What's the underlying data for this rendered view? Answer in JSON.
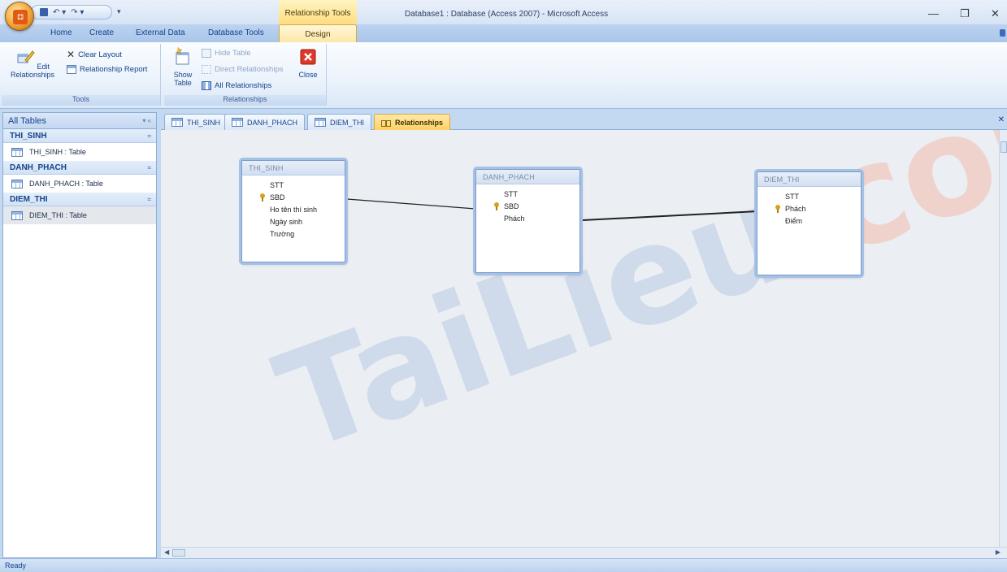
{
  "window": {
    "title": "Database1 : Database (Access 2007) - Microsoft Access",
    "context_tab_title": "Relationship Tools",
    "minimize": "—",
    "restore": "❐",
    "close": "✕"
  },
  "qat": {
    "undo": "↶ ▾",
    "redo": "↷ ▾",
    "dropdown": "▾"
  },
  "ribbon_tabs": [
    "Home",
    "Create",
    "External Data",
    "Database Tools",
    "Design"
  ],
  "ribbon": {
    "tools_group": {
      "label": "Tools",
      "edit_relationships": "Edit Relationships",
      "clear_layout": "Clear Layout",
      "relationship_report": "Relationship Report"
    },
    "relationships_group": {
      "label": "Relationships",
      "show_table": "Show Table",
      "hide_table": "Hide Table",
      "direct_relationships": "Direct Relationships",
      "all_relationships": "All Relationships",
      "close": "Close"
    }
  },
  "nav_pane": {
    "header": "All Tables",
    "header_controls": "▾ «",
    "groups": [
      {
        "name": "THI_SINH",
        "item": "THI_SINH : Table"
      },
      {
        "name": "DANH_PHACH",
        "item": "DANH_PHACH : Table"
      },
      {
        "name": "DIEM_THI",
        "item": "DIEM_THI : Table"
      }
    ],
    "collapse_glyph": "≈"
  },
  "doc_tabs": [
    "THI_SINH",
    "DANH_PHACH",
    "DIEM_THI",
    "Relationships"
  ],
  "doc_close": "✕",
  "tables": {
    "thi_sinh": {
      "title": "THI_SINH",
      "fields": [
        "STT",
        "SBD",
        "Ho tên thí sinh",
        "Ngày sinh",
        "Trường"
      ]
    },
    "danh_phach": {
      "title": "DANH_PHACH",
      "fields": [
        "STT",
        "SBD",
        "Phách"
      ]
    },
    "diem_thi": {
      "title": "DIEM_THI",
      "fields": [
        "STT",
        "Phách",
        "Điểm"
      ]
    }
  },
  "status": "Ready",
  "watermark": {
    "part1": "Tai",
    "part2": "Lieu",
    "part3": ".com"
  },
  "colors": {
    "watermark_blue": "#b9cbe5",
    "watermark_red": "#f3c7be",
    "accent": "#15428b"
  }
}
